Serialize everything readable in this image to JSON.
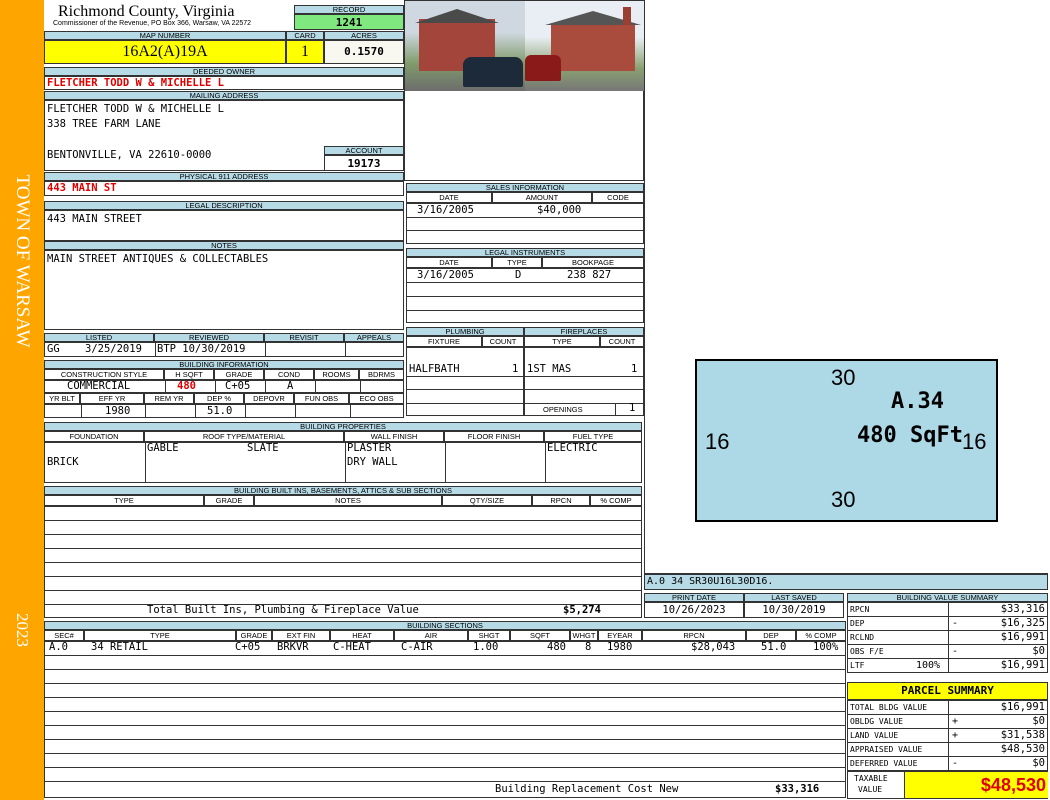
{
  "sidebar": {
    "town": "TOWN OF WARSAW",
    "year": "2023"
  },
  "header": {
    "county": "Richmond County, Virginia",
    "commissioner": "Commissioner of the Revenue, PO Box 366, Warsaw, VA 22572",
    "record_label": "RECORD",
    "record": "1241",
    "map_label": "MAP NUMBER",
    "map": "16A2(A)19A",
    "card_label": "CARD",
    "card": "1",
    "acres_label": "ACRES",
    "acres": "0.1570"
  },
  "owner": {
    "label": "DEEDED OWNER",
    "name": "FLETCHER TODD W & MICHELLE L"
  },
  "mailing": {
    "label": "MAILING ADDRESS",
    "line1": "FLETCHER TODD W & MICHELLE L",
    "line2": "338 TREE FARM LANE",
    "line3": "BENTONVILLE, VA 22610-0000",
    "account_label": "ACCOUNT",
    "account": "19173"
  },
  "physical": {
    "label": "PHYSICAL 911 ADDRESS",
    "address": "443 MAIN ST"
  },
  "legal": {
    "label": "LEGAL DESCRIPTION",
    "text": "443 MAIN STREET"
  },
  "notes": {
    "label": "NOTES",
    "text": "MAIN STREET ANTIQUES & COLLECTABLES"
  },
  "status": {
    "listed_label": "LISTED",
    "listed_by": "GG",
    "listed": "3/25/2019",
    "reviewed_label": "REVIEWED",
    "reviewed": "BTP 10/30/2019",
    "revisit_label": "REVISIT",
    "appeals_label": "APPEALS"
  },
  "building_info": {
    "label": "BUILDING INFORMATION",
    "cols1": [
      "CONSTRUCTION STYLE",
      "H SQFT",
      "GRADE",
      "COND",
      "ROOMS",
      "BDRMS"
    ],
    "style": "COMMERCIAL",
    "hsqft": "480",
    "grade": "C+05",
    "cond": "A",
    "cols2": [
      "YR BLT",
      "EFF YR",
      "REM YR",
      "DEP %",
      "DEPOVR",
      "FUN OBS",
      "ECO OBS"
    ],
    "eff_yr": "1980",
    "dep": "51.0"
  },
  "sales": {
    "label": "SALES INFORMATION",
    "cols": [
      "DATE",
      "AMOUNT",
      "CODE"
    ],
    "date": "3/16/2005",
    "amount": "$40,000"
  },
  "instruments": {
    "label": "LEGAL INSTRUMENTS",
    "cols": [
      "DATE",
      "TYPE",
      "BOOKPAGE"
    ],
    "date": "3/16/2005",
    "type": "D",
    "bookpage": "238 827"
  },
  "plumbing": {
    "label": "PLUMBING",
    "cols": [
      "FIXTURE",
      "COUNT"
    ],
    "fixture": "HALFBATH",
    "count": "1"
  },
  "fireplaces": {
    "label": "FIREPLACES",
    "cols": [
      "TYPE",
      "COUNT"
    ],
    "type": "1ST MAS",
    "count": "1",
    "openings_label": "OPENINGS",
    "openings": "1"
  },
  "properties": {
    "label": "BUILDING PROPERTIES",
    "cols": [
      "FOUNDATION",
      "ROOF TYPE/MATERIAL",
      "WALL FINISH",
      "FLOOR FINISH",
      "FUEL TYPE"
    ],
    "foundation": "BRICK",
    "roof_type": "GABLE",
    "roof_mat": "SLATE",
    "wall1": "PLASTER",
    "wall2": "DRY WALL",
    "fuel": "ELECTRIC"
  },
  "builtins": {
    "label": "BUILDING BUILT INS, BASEMENTS, ATTICS & SUB SECTIONS",
    "cols": [
      "TYPE",
      "GRADE",
      "NOTES",
      "QTY/SIZE",
      "RPCN",
      "% COMP"
    ],
    "total_label": "Total Built Ins, Plumbing & Fireplace Value",
    "total": "$5,274"
  },
  "sketch": {
    "top": "30",
    "bottom": "30",
    "left": "16",
    "right": "16",
    "section": "A.34",
    "area": "480 SqFt",
    "code": "A.0   34   SR30U16L30D16."
  },
  "dates": {
    "print_label": "PRINT DATE",
    "print": "10/26/2023",
    "saved_label": "LAST SAVED",
    "saved": "10/30/2019"
  },
  "sections": {
    "label": "BUILDING SECTIONS",
    "cols": [
      "SEC#",
      "TYPE",
      "GRADE",
      "EXT FIN",
      "HEAT",
      "AIR",
      "SHGT",
      "SQFT",
      "WHGT",
      "EYEAR",
      "RPCN",
      "DEP",
      "% COMP"
    ],
    "row": [
      "A.0",
      "34 RETAIL",
      "C+05",
      "BRKVR",
      "C-HEAT",
      "C-AIR",
      "1.00",
      "480",
      "8",
      "1980",
      "$28,043",
      "51.0",
      "100%"
    ],
    "replacement_label": "Building Replacement Cost New",
    "replacement": "$33,316"
  },
  "value_summary": {
    "label": "BUILDING VALUE SUMMARY",
    "rows": [
      {
        "k": "RPCN",
        "s": "",
        "v": "$33,316"
      },
      {
        "k": "DEP",
        "s": "-",
        "v": "$16,325"
      },
      {
        "k": "RCLND",
        "s": "",
        "v": "$16,991"
      },
      {
        "k": "OBS F/E",
        "s": "-",
        "v": "$0"
      },
      {
        "k": "LTF",
        "p": "100%",
        "s": "",
        "v": "$16,991"
      }
    ]
  },
  "parcel": {
    "label": "PARCEL SUMMARY",
    "rows": [
      {
        "k": "TOTAL BLDG VALUE",
        "s": "",
        "v": "$16,991"
      },
      {
        "k": "OBLDG VALUE",
        "s": "+",
        "v": "$0"
      },
      {
        "k": "LAND VALUE",
        "s": "+",
        "v": "$31,538"
      },
      {
        "k": "APPRAISED VALUE",
        "s": "",
        "v": "$48,530"
      },
      {
        "k": "DEFERRED VALUE",
        "s": "-",
        "v": "$0"
      }
    ],
    "taxable_label1": "TAXABLE",
    "taxable_label2": "VALUE",
    "taxable": "$48,530"
  },
  "colors": {
    "sidebar": "#ffa500",
    "header": "#b7dbe6",
    "highlight": "#ffff00",
    "record": "#7fe87f",
    "sketch": "#add8e6",
    "red": "#e00000"
  }
}
